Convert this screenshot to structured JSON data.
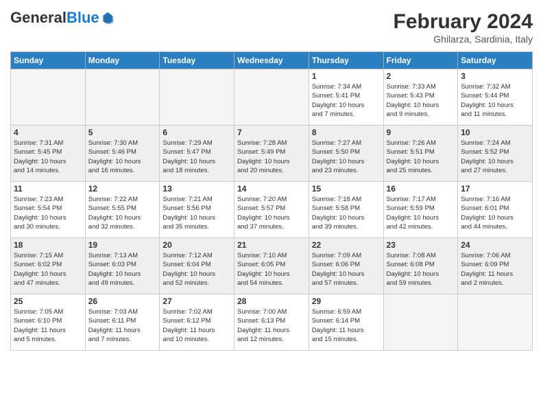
{
  "header": {
    "logo_general": "General",
    "logo_blue": "Blue",
    "month_year": "February 2024",
    "location": "Ghilarza, Sardinia, Italy"
  },
  "weekdays": [
    "Sunday",
    "Monday",
    "Tuesday",
    "Wednesday",
    "Thursday",
    "Friday",
    "Saturday"
  ],
  "rows": [
    {
      "shaded": false,
      "cells": [
        {
          "empty": true
        },
        {
          "empty": true
        },
        {
          "empty": true
        },
        {
          "empty": true
        },
        {
          "day": "1",
          "info": "Sunrise: 7:34 AM\nSunset: 5:41 PM\nDaylight: 10 hours\nand 7 minutes."
        },
        {
          "day": "2",
          "info": "Sunrise: 7:33 AM\nSunset: 5:43 PM\nDaylight: 10 hours\nand 9 minutes."
        },
        {
          "day": "3",
          "info": "Sunrise: 7:32 AM\nSunset: 5:44 PM\nDaylight: 10 hours\nand 11 minutes."
        }
      ]
    },
    {
      "shaded": true,
      "cells": [
        {
          "day": "4",
          "info": "Sunrise: 7:31 AM\nSunset: 5:45 PM\nDaylight: 10 hours\nand 14 minutes."
        },
        {
          "day": "5",
          "info": "Sunrise: 7:30 AM\nSunset: 5:46 PM\nDaylight: 10 hours\nand 16 minutes."
        },
        {
          "day": "6",
          "info": "Sunrise: 7:29 AM\nSunset: 5:47 PM\nDaylight: 10 hours\nand 18 minutes."
        },
        {
          "day": "7",
          "info": "Sunrise: 7:28 AM\nSunset: 5:49 PM\nDaylight: 10 hours\nand 20 minutes."
        },
        {
          "day": "8",
          "info": "Sunrise: 7:27 AM\nSunset: 5:50 PM\nDaylight: 10 hours\nand 23 minutes."
        },
        {
          "day": "9",
          "info": "Sunrise: 7:26 AM\nSunset: 5:51 PM\nDaylight: 10 hours\nand 25 minutes."
        },
        {
          "day": "10",
          "info": "Sunrise: 7:24 AM\nSunset: 5:52 PM\nDaylight: 10 hours\nand 27 minutes."
        }
      ]
    },
    {
      "shaded": false,
      "cells": [
        {
          "day": "11",
          "info": "Sunrise: 7:23 AM\nSunset: 5:54 PM\nDaylight: 10 hours\nand 30 minutes."
        },
        {
          "day": "12",
          "info": "Sunrise: 7:22 AM\nSunset: 5:55 PM\nDaylight: 10 hours\nand 32 minutes."
        },
        {
          "day": "13",
          "info": "Sunrise: 7:21 AM\nSunset: 5:56 PM\nDaylight: 10 hours\nand 35 minutes."
        },
        {
          "day": "14",
          "info": "Sunrise: 7:20 AM\nSunset: 5:57 PM\nDaylight: 10 hours\nand 37 minutes."
        },
        {
          "day": "15",
          "info": "Sunrise: 7:18 AM\nSunset: 5:58 PM\nDaylight: 10 hours\nand 39 minutes."
        },
        {
          "day": "16",
          "info": "Sunrise: 7:17 AM\nSunset: 5:59 PM\nDaylight: 10 hours\nand 42 minutes."
        },
        {
          "day": "17",
          "info": "Sunrise: 7:16 AM\nSunset: 6:01 PM\nDaylight: 10 hours\nand 44 minutes."
        }
      ]
    },
    {
      "shaded": true,
      "cells": [
        {
          "day": "18",
          "info": "Sunrise: 7:15 AM\nSunset: 6:02 PM\nDaylight: 10 hours\nand 47 minutes."
        },
        {
          "day": "19",
          "info": "Sunrise: 7:13 AM\nSunset: 6:03 PM\nDaylight: 10 hours\nand 49 minutes."
        },
        {
          "day": "20",
          "info": "Sunrise: 7:12 AM\nSunset: 6:04 PM\nDaylight: 10 hours\nand 52 minutes."
        },
        {
          "day": "21",
          "info": "Sunrise: 7:10 AM\nSunset: 6:05 PM\nDaylight: 10 hours\nand 54 minutes."
        },
        {
          "day": "22",
          "info": "Sunrise: 7:09 AM\nSunset: 6:06 PM\nDaylight: 10 hours\nand 57 minutes."
        },
        {
          "day": "23",
          "info": "Sunrise: 7:08 AM\nSunset: 6:08 PM\nDaylight: 10 hours\nand 59 minutes."
        },
        {
          "day": "24",
          "info": "Sunrise: 7:06 AM\nSunset: 6:09 PM\nDaylight: 11 hours\nand 2 minutes."
        }
      ]
    },
    {
      "shaded": false,
      "cells": [
        {
          "day": "25",
          "info": "Sunrise: 7:05 AM\nSunset: 6:10 PM\nDaylight: 11 hours\nand 5 minutes."
        },
        {
          "day": "26",
          "info": "Sunrise: 7:03 AM\nSunset: 6:11 PM\nDaylight: 11 hours\nand 7 minutes."
        },
        {
          "day": "27",
          "info": "Sunrise: 7:02 AM\nSunset: 6:12 PM\nDaylight: 11 hours\nand 10 minutes."
        },
        {
          "day": "28",
          "info": "Sunrise: 7:00 AM\nSunset: 6:13 PM\nDaylight: 11 hours\nand 12 minutes."
        },
        {
          "day": "29",
          "info": "Sunrise: 6:59 AM\nSunset: 6:14 PM\nDaylight: 11 hours\nand 15 minutes."
        },
        {
          "empty": true
        },
        {
          "empty": true
        }
      ]
    }
  ]
}
